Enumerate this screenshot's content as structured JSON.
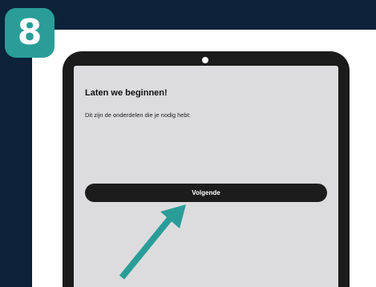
{
  "step": {
    "number": "8"
  },
  "screen": {
    "title": "Laten we beginnen!",
    "subtitle": "Dit zijn de onderdelen die je nodig hebt:",
    "next_button_label": "Volgende"
  },
  "colors": {
    "background": "#0b2239",
    "accent": "#2a9d98",
    "card": "#ffffff",
    "tablet_frame": "#1b1b1b",
    "screen": "#dcdcde",
    "button": "#1c1c1c"
  },
  "icons": {
    "pointer_arrow": "arrow-icon",
    "camera": "camera-dot"
  }
}
